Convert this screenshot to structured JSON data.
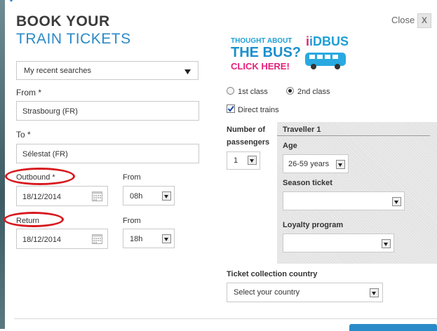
{
  "header": {
    "title_line1": "BOOK YOUR",
    "title_line2": "TRAIN TICKETS",
    "close_label": "Close",
    "close_x": "X"
  },
  "banner": {
    "line1": "THOUGHT ABOUT",
    "brand": "iDBUS",
    "line2": "THE BUS?",
    "cta": "CLICK HERE!"
  },
  "recent": {
    "selected": "My recent searches"
  },
  "from": {
    "label": "From *",
    "value": "Strasbourg (FR)"
  },
  "to": {
    "label": "To *",
    "value": "Sélestat (FR)"
  },
  "outbound": {
    "label": "Outbound *",
    "date": "18/12/2014",
    "from_label": "From",
    "time": "08h"
  },
  "return_trip": {
    "label": "Return",
    "date": "18/12/2014",
    "from_label": "From",
    "time": "18h"
  },
  "travel_class": {
    "first": "1st class",
    "second": "2nd class",
    "selected": "2nd class"
  },
  "direct": {
    "label": "Direct trains",
    "checked": true
  },
  "passengers": {
    "label_line1": "Number of",
    "label_line2": "passengers",
    "value": "1"
  },
  "traveller": {
    "title": "Traveller 1",
    "age_label": "Age",
    "age_value": "26-59 years",
    "season_label": "Season ticket",
    "season_value": "",
    "loyalty_label": "Loyalty program",
    "loyalty_value": ""
  },
  "country": {
    "label": "Ticket collection country",
    "placeholder": "Select your country"
  },
  "colors": {
    "accent": "#2a8ac7",
    "annotation": "#d7191e",
    "banner_blue": "#1f9fd6",
    "banner_pink": "#e5207a"
  }
}
